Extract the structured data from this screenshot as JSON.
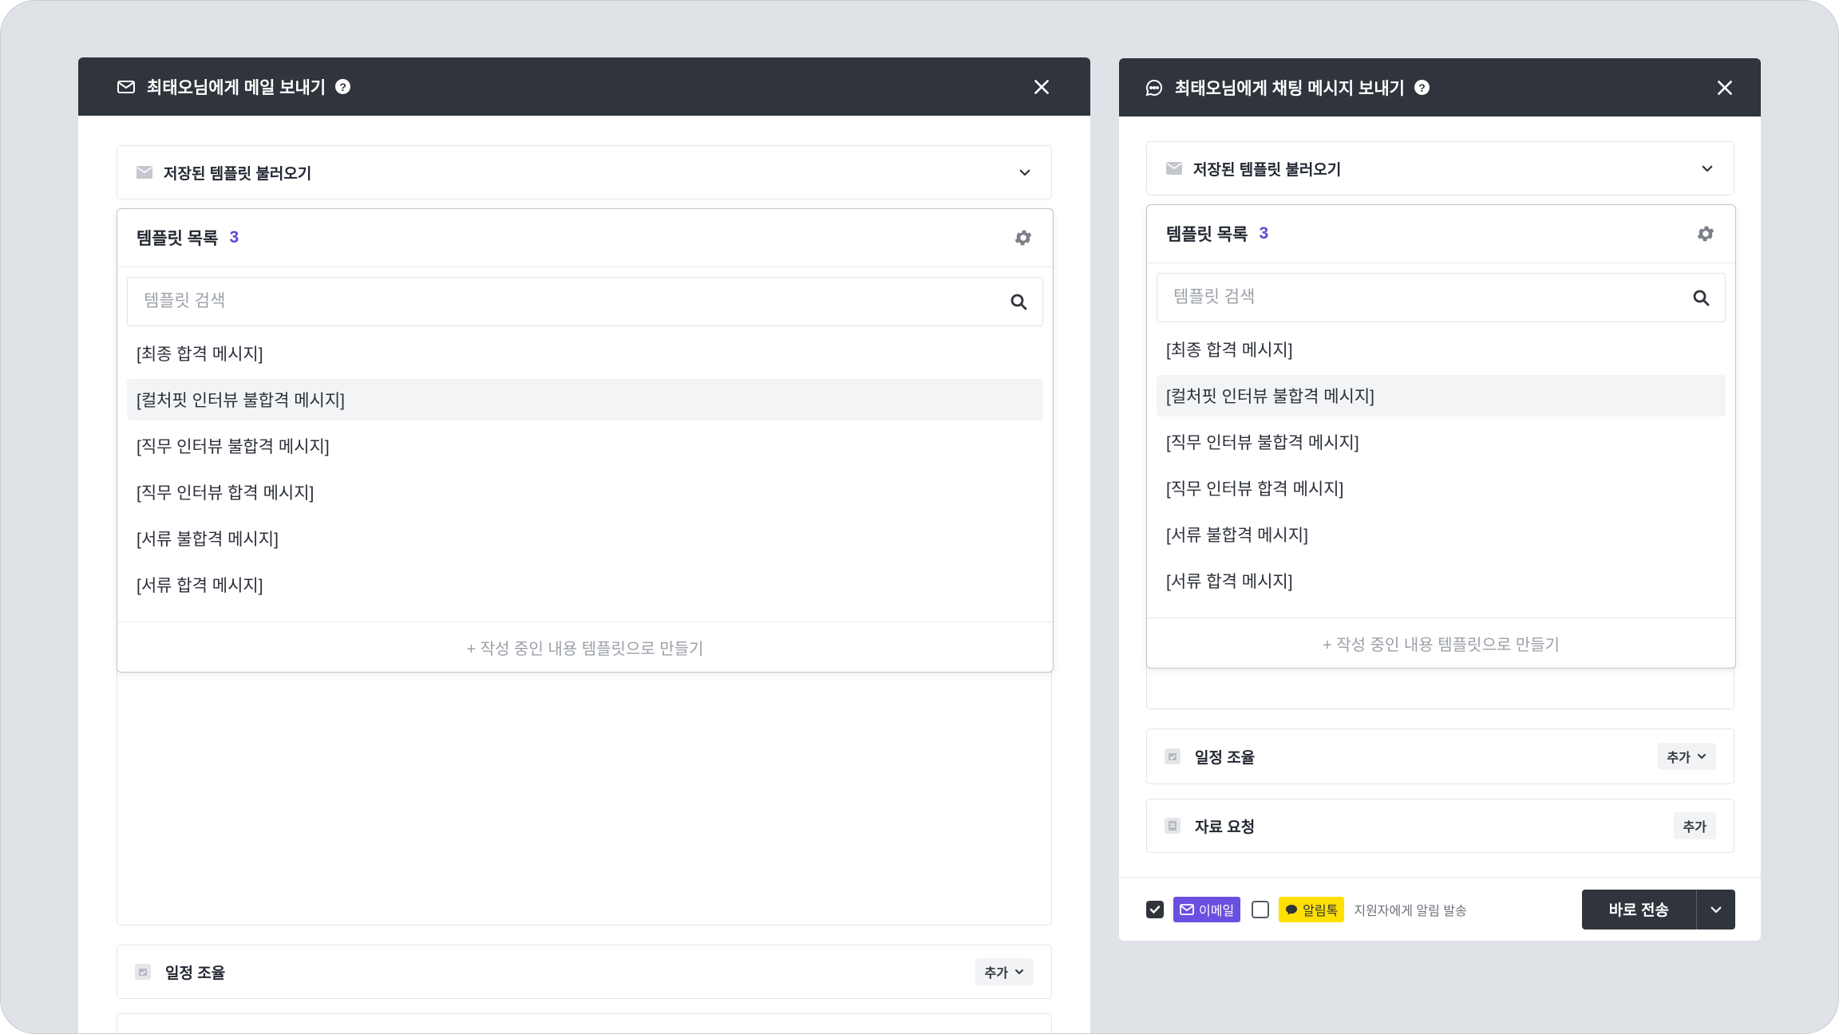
{
  "email_modal": {
    "title": "최태오님에게 메일 보내기",
    "help": "?",
    "template_trigger": "저장된 템플릿 불러오기",
    "dropdown": {
      "title": "템플릿 목록",
      "count": "3",
      "search_placeholder": "템플릿 검색",
      "items": [
        "[최종 합격 메시지]",
        "[컬처핏 인터뷰 불합격 메시지]",
        "[직무 인터뷰 불합격 메시지]",
        "[직무 인터뷰 합격 메시지]",
        "[서류 불합격 메시지]",
        "[서류 합격 메시지]"
      ],
      "create_label": "+ 작성 중인 내용 템플릿으로 만들기"
    },
    "schedule_label": "일정 조율",
    "add_label": "추가"
  },
  "chat_modal": {
    "title": "최태오님에게 채팅 메시지 보내기",
    "help": "?",
    "template_trigger": "저장된 템플릿 불러오기",
    "dropdown": {
      "title": "템플릿 목록",
      "count": "3",
      "search_placeholder": "템플릿 검색",
      "items": [
        "[최종 합격 메시지]",
        "[컬처핏 인터뷰 불합격 메시지]",
        "[직무 인터뷰 불합격 메시지]",
        "[직무 인터뷰 합격 메시지]",
        "[서류 불합격 메시지]",
        "[서류 합격 메시지]"
      ],
      "create_label": "+ 작성 중인 내용 템플릿으로 만들기"
    },
    "schedule_label": "일정 조율",
    "schedule_add": "추가",
    "request_label": "자료 요청",
    "request_add": "추가",
    "footer": {
      "email_tag": "이메일",
      "alimtalk_tag": "알림톡",
      "note": "지원자에게 알림 발송",
      "send_label": "바로 전송"
    }
  },
  "colors": {
    "header": "#30343c",
    "accent": "#5b49d6",
    "email_tag": "#6a4fe0",
    "kakao_tag": "#ffe000"
  },
  "state": {
    "email_checked": true,
    "alimtalk_checked": false
  }
}
